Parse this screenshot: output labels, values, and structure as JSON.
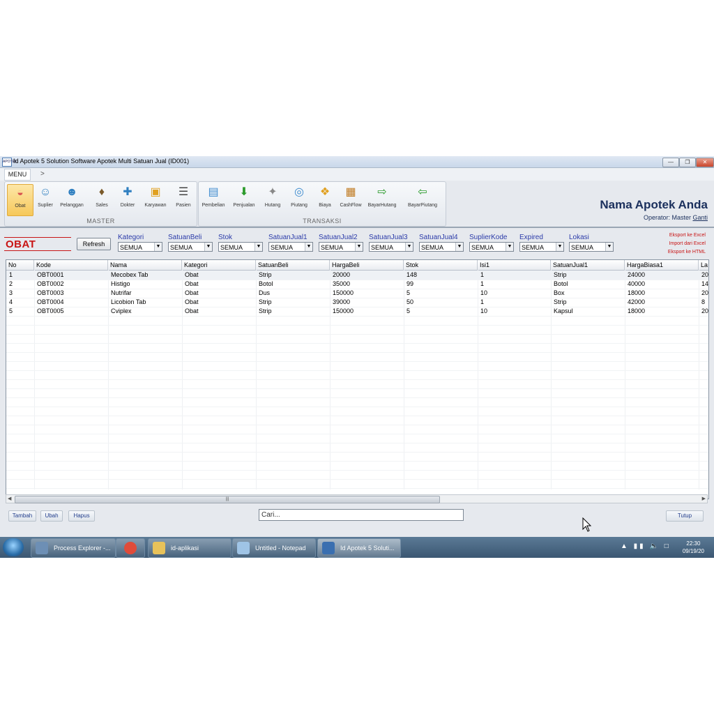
{
  "window": {
    "title": "Id Apotek 5 Solution Software Apotek Multi Satuan Jual (ID001)",
    "icon_text": "APOTEK"
  },
  "menu": {
    "label": "MENU",
    "more": ">"
  },
  "ribbon": {
    "master": {
      "label": "MASTER",
      "items": [
        {
          "label": "Obat",
          "icon": "pill-icon",
          "color": "#d9534f"
        },
        {
          "label": "Suplier",
          "icon": "person-icon",
          "color": "#2f7fc0"
        },
        {
          "label": "Pelanggan",
          "icon": "group-icon",
          "color": "#2f7fc0"
        },
        {
          "label": "Sales",
          "icon": "sales-icon",
          "color": "#7a5a2a"
        },
        {
          "label": "Dokter",
          "icon": "doctor-icon",
          "color": "#2f7fc0"
        },
        {
          "label": "Karyawan",
          "icon": "folder-icon",
          "color": "#e0a020"
        },
        {
          "label": "Pasien",
          "icon": "stethoscope-icon",
          "color": "#444444"
        }
      ]
    },
    "transaksi": {
      "label": "TRANSAKSI",
      "items": [
        {
          "label": "Pembelian",
          "icon": "document-icon",
          "color": "#3f8ccf"
        },
        {
          "label": "Penjualan",
          "icon": "cart-icon",
          "color": "#2a9a2a"
        },
        {
          "label": "Hutang",
          "icon": "hutang-icon",
          "color": "#888888"
        },
        {
          "label": "Piutang",
          "icon": "money-hand-icon",
          "color": "#3f8ccf"
        },
        {
          "label": "Biaya",
          "icon": "puzzle-icon",
          "color": "#e0a020"
        },
        {
          "label": "CashFlow",
          "icon": "spreadsheet-icon",
          "color": "#c07a20"
        },
        {
          "label": "BayarHutang",
          "icon": "pay-out-icon",
          "color": "#2a9a2a"
        },
        {
          "label": "BayarPiutang",
          "icon": "pay-in-icon",
          "color": "#2a9a2a"
        }
      ]
    }
  },
  "header": {
    "shop_name": "Nama Apotek Anda",
    "operator_prefix": "Operator: Master",
    "operator_link": "Ganti"
  },
  "page": {
    "title": "OBAT",
    "refresh": "Refresh"
  },
  "filters": [
    {
      "label": "Kategori",
      "value": "SEMUA"
    },
    {
      "label": "SatuanBeli",
      "value": "SEMUA"
    },
    {
      "label": "Stok",
      "value": "SEMUA"
    },
    {
      "label": "SatuanJual1",
      "value": "SEMUA"
    },
    {
      "label": "SatuanJual2",
      "value": "SEMUA"
    },
    {
      "label": "SatuanJual3",
      "value": "SEMUA"
    },
    {
      "label": "SatuanJual4",
      "value": "SEMUA"
    },
    {
      "label": "SuplierKode",
      "value": "SEMUA"
    },
    {
      "label": "Expired",
      "value": "SEMUA"
    },
    {
      "label": "Lokasi",
      "value": "SEMUA"
    }
  ],
  "export_links": [
    "Eksport ke Excel",
    "Import dari Excel",
    "Eksport ke HTML"
  ],
  "table": {
    "columns": [
      "No",
      "Kode",
      "Nama",
      "Kategori",
      "SatuanBeli",
      "HargaBeli",
      "Stok",
      "Isi1",
      "SatuanJual1",
      "HargaBiasa1",
      "La"
    ],
    "rows": [
      [
        "1",
        "OBT0001",
        "Mecobex Tab",
        "Obat",
        "Strip",
        "20000",
        "148",
        "1",
        "Strip",
        "24000",
        "20"
      ],
      [
        "2",
        "OBT0002",
        "Histigo",
        "Obat",
        "Botol",
        "35000",
        "99",
        "1",
        "Botol",
        "40000",
        "14"
      ],
      [
        "3",
        "OBT0003",
        "Nutrifar",
        "Obat",
        "Dus",
        "150000",
        "5",
        "10",
        "Box",
        "18000",
        "20"
      ],
      [
        "4",
        "OBT0004",
        "Licobion Tab",
        "Obat",
        "Strip",
        "39000",
        "50",
        "1",
        "Strip",
        "42000",
        "8"
      ],
      [
        "5",
        "OBT0005",
        "Cviplex",
        "Obat",
        "Strip",
        "150000",
        "5",
        "10",
        "Kapsul",
        "18000",
        "20"
      ]
    ]
  },
  "actions": {
    "tambah": "Tambah",
    "ubah": "Ubah",
    "hapus": "Hapus",
    "tutup": "Tutup",
    "search_placeholder": "Cari..."
  },
  "taskbar": {
    "items": [
      {
        "label": "Process Explorer -...",
        "color": "#6d8fb5"
      },
      {
        "label": "",
        "color": "#e04b3a"
      },
      {
        "label": "id-aplikasi",
        "color": "#e8c25a"
      },
      {
        "label": "Untitled - Notepad",
        "color": "#9fc4e6"
      },
      {
        "label": "Id Apotek 5 Soluti...",
        "color": "#3a6fb0"
      }
    ],
    "time": "22:30",
    "date": "09/19/20"
  }
}
